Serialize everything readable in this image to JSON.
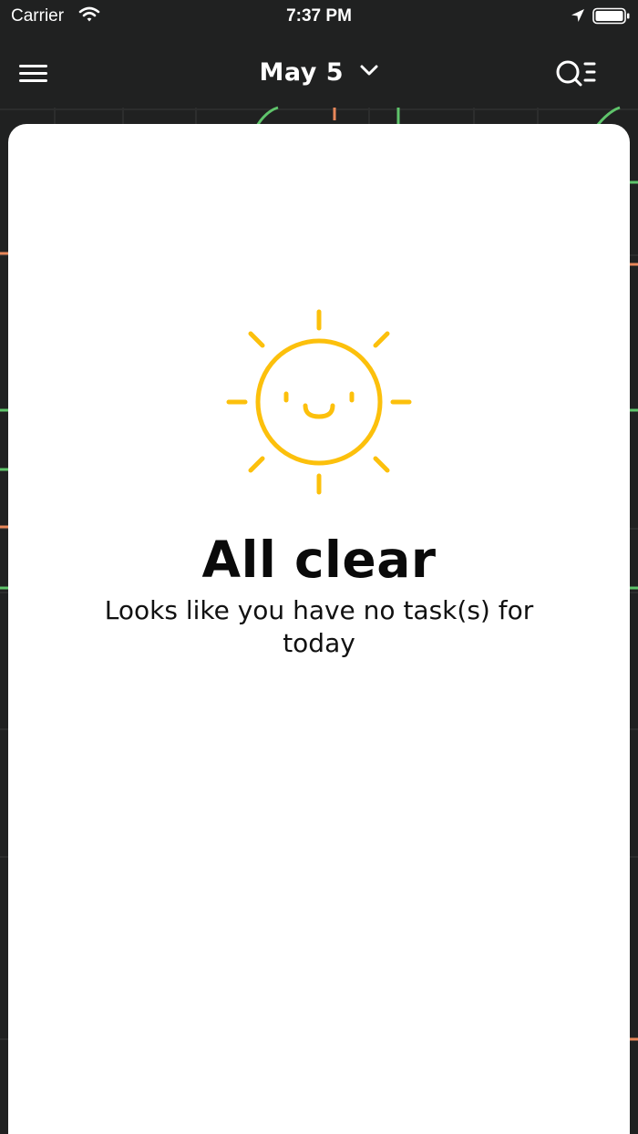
{
  "status_bar": {
    "carrier": "Carrier",
    "time": "7:37 PM",
    "icons": [
      "wifi-icon",
      "location-arrow-icon",
      "battery-icon"
    ]
  },
  "nav_bar": {
    "menu_icon": "hamburger-menu-icon",
    "date": "May 5",
    "date_icon": "chevron-down-icon",
    "right_icon": "search-list-icon"
  },
  "empty_state": {
    "icon": "smiling-sun-icon",
    "title": "All clear",
    "message": "Looks like you have no task(s) for today"
  },
  "colors": {
    "sun": "#FCC00C",
    "card": "#FFFFFF",
    "nav_background": "#1E1F1F",
    "map_road_green": "#5FC46B",
    "map_road_orange": "#E8875A"
  }
}
